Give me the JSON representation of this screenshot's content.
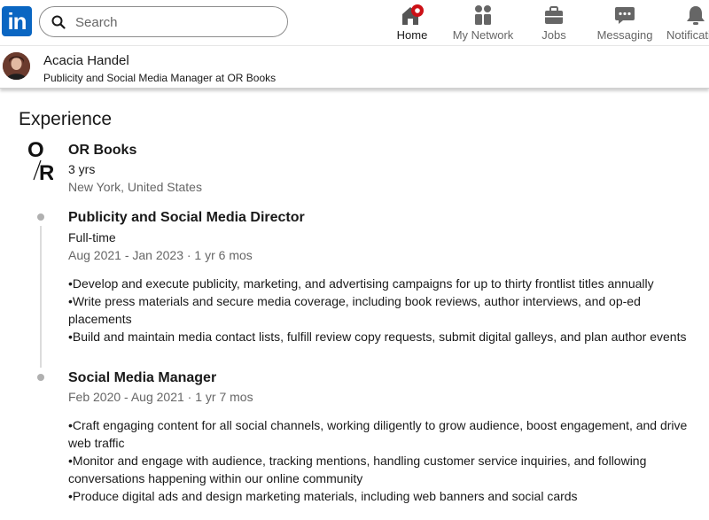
{
  "nav": {
    "logo_text": "in",
    "search_placeholder": "Search",
    "items": [
      {
        "label": "Home"
      },
      {
        "label": "My Network"
      },
      {
        "label": "Jobs"
      },
      {
        "label": "Messaging"
      },
      {
        "label": "Notifications"
      }
    ]
  },
  "profile": {
    "name": "Acacia Handel",
    "headline": "Publicity and Social Media Manager at OR Books"
  },
  "experience": {
    "title": "Experience",
    "company": {
      "logo_text_top": "O",
      "logo_text_bottom": "R",
      "name": "OR Books",
      "duration": "3 yrs",
      "location": "New York, United States"
    },
    "roles": [
      {
        "title": "Publicity and Social Media Director",
        "type": "Full-time",
        "dates": "Aug 2021 - Jan 2023 · 1 yr 6 mos",
        "bullets": [
          "•Develop and execute publicity, marketing, and advertising campaigns for up to thirty frontlist titles annually",
          "•Write press materials and secure media coverage, including book reviews, author interviews, and op-ed placements",
          "•Build and maintain media contact lists, fulfill review copy requests, submit digital galleys, and plan author events"
        ]
      },
      {
        "title": "Social Media Manager",
        "dates": "Feb 2020 - Aug 2021 · 1 yr 7 mos",
        "bullets": [
          "•Craft engaging content for all social channels, working diligently to grow audience, boost engagement, and drive web traffic",
          "•Monitor and engage with audience, tracking mentions, handling customer service inquiries, and following conversations happening within our online community",
          "•Produce digital ads and design marketing materials, including web banners and social cards"
        ]
      }
    ]
  },
  "colors": {
    "brand": "#0a66c2",
    "notification_badge": "#cc1016",
    "text_primary": "#191919",
    "text_secondary": "#666666"
  }
}
